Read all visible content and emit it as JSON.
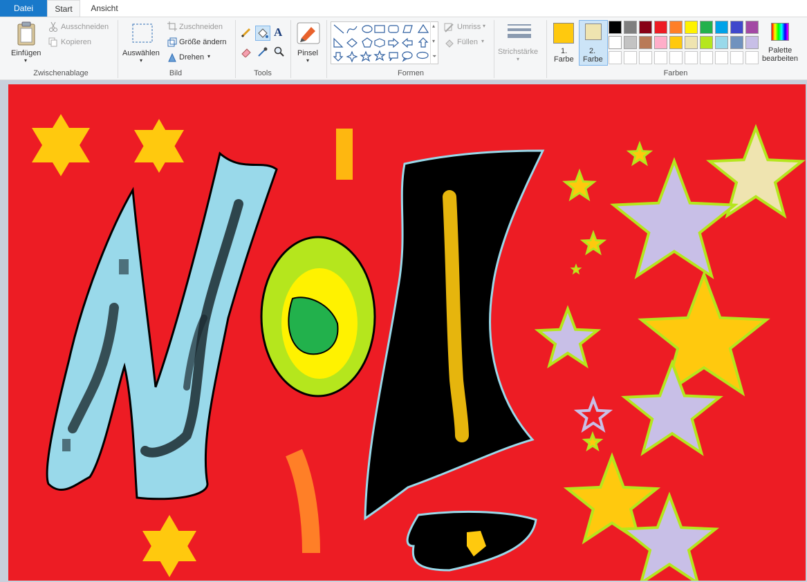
{
  "tabs": {
    "file": "Datei",
    "start": "Start",
    "view": "Ansicht"
  },
  "clipboard": {
    "paste": "Einfügen",
    "cut": "Ausschneiden",
    "copy": "Kopieren",
    "group": "Zwischenablage"
  },
  "image": {
    "select": "Auswählen",
    "crop": "Zuschneiden",
    "resize": "Größe ändern",
    "rotate": "Drehen",
    "group": "Bild"
  },
  "tools": {
    "group": "Tools"
  },
  "brush": {
    "label": "Pinsel"
  },
  "shapes": {
    "group": "Formen",
    "outline": "Umriss",
    "fill": "Füllen"
  },
  "stroke": {
    "label": "Strichstärke"
  },
  "colors": {
    "color1_line1": "1.",
    "color1_line2": "Farbe",
    "color2_line1": "2.",
    "color2_line2": "Farbe",
    "group": "Farben",
    "edit_line1": "Palette",
    "edit_line2": "bearbeiten",
    "color1": "#ffc90e",
    "color2": "#efe4b0",
    "row1": [
      "#000000",
      "#7f7f7f",
      "#880015",
      "#ed1c24",
      "#ff7f27",
      "#fff200",
      "#22b14c",
      "#00a2e8",
      "#3f48cc",
      "#a349a4"
    ],
    "row2": [
      "#ffffff",
      "#c3c3c3",
      "#b97a57",
      "#ffaec9",
      "#ffc90e",
      "#efe4b0",
      "#b5e61d",
      "#99d9ea",
      "#7092be",
      "#c8bfe7"
    ]
  },
  "canvas": {
    "background": "#ed1c24"
  }
}
